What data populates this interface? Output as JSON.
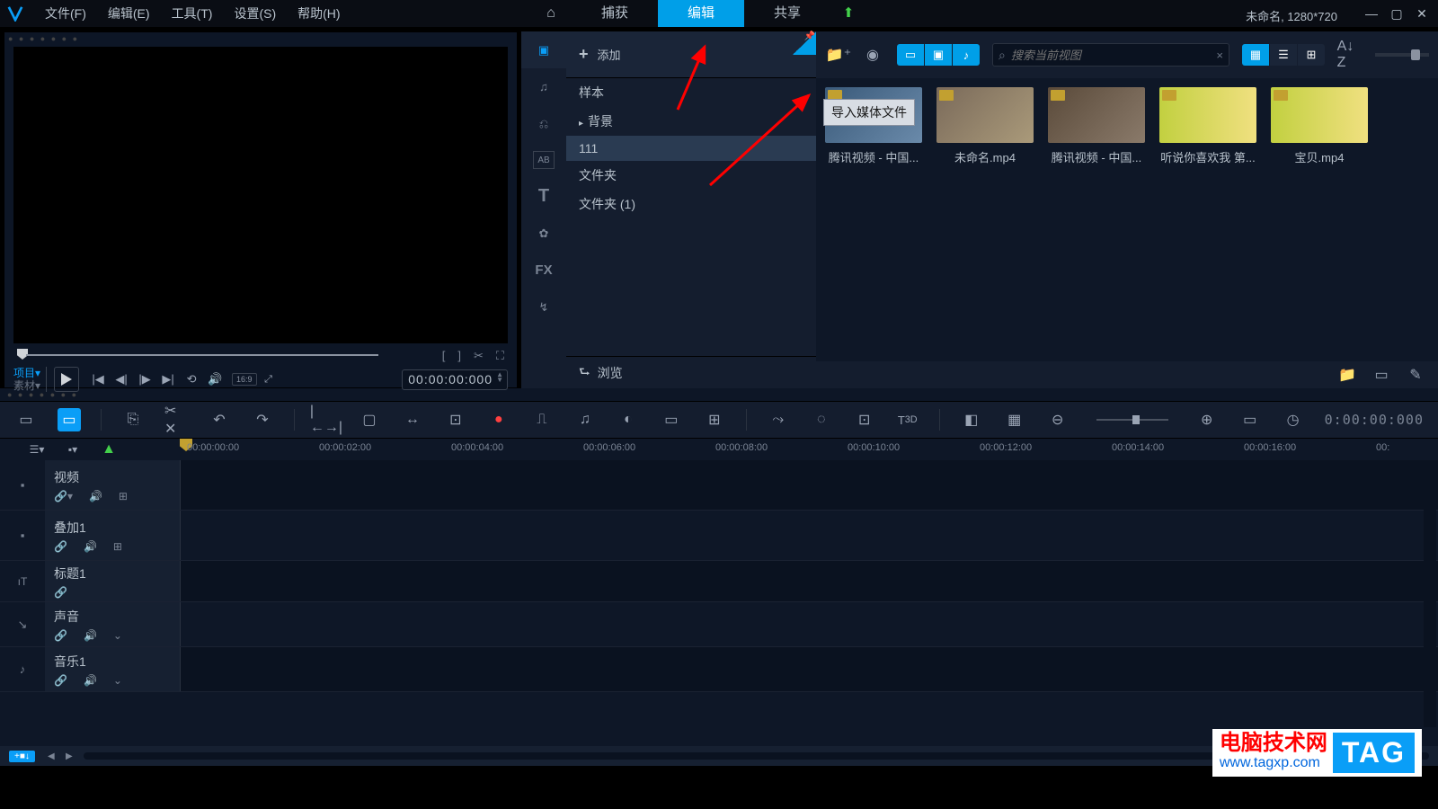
{
  "menu": {
    "file": "文件(F)",
    "edit": "编辑(E)",
    "tools": "工具(T)",
    "settings": "设置(S)",
    "help": "帮助(H)"
  },
  "top_tabs": {
    "home": "⌂",
    "capture": "捕获",
    "edit": "编辑",
    "share": "共享",
    "export": "⬆"
  },
  "project_label": "未命名, 1280*720",
  "preview": {
    "tab_project": "项目▾",
    "tab_clip": "素材▾",
    "timecode": "00:00:00:000",
    "ratio": "16:9"
  },
  "library": {
    "add": "添加",
    "folders": [
      "样本",
      "背景",
      "111",
      "文件夹",
      "文件夹 (1)"
    ],
    "browse": "浏览",
    "search_placeholder": "搜索当前视图",
    "tooltip": "导入媒体文件",
    "thumbs": [
      {
        "cap": "腾讯视频 - 中国..."
      },
      {
        "cap": "未命名.mp4"
      },
      {
        "cap": "腾讯视频 - 中国..."
      },
      {
        "cap": "听说你喜欢我 第..."
      },
      {
        "cap": "宝贝.mp4"
      }
    ]
  },
  "timeline": {
    "timecode": "0:00:00:000",
    "ruler": [
      "00:00:00:00",
      "00:00:02:00",
      "00:00:04:00",
      "00:00:06:00",
      "00:00:08:00",
      "00:00:10:00",
      "00:00:12:00",
      "00:00:14:00",
      "00:00:16:00",
      "00:"
    ]
  },
  "tracks": [
    {
      "name": "视频",
      "icon": "■",
      "btns": [
        "🔗",
        "🔊",
        "⊞"
      ]
    },
    {
      "name": "叠加1",
      "icon": "■",
      "btns": [
        "🔗",
        "🔊",
        "⊞"
      ]
    },
    {
      "name": "标题1",
      "icon": "T",
      "btns": [
        "🔗"
      ]
    },
    {
      "name": "声音",
      "icon": "∿",
      "btns": [
        "🔗",
        "🔊",
        "⌄"
      ]
    },
    {
      "name": "音乐1",
      "icon": "♪",
      "btns": [
        "🔗",
        "🔊",
        "⌄"
      ]
    }
  ],
  "watermark": {
    "cn": "电脑技术网",
    "url": "www.tagxp.com",
    "tag": "TAG"
  }
}
